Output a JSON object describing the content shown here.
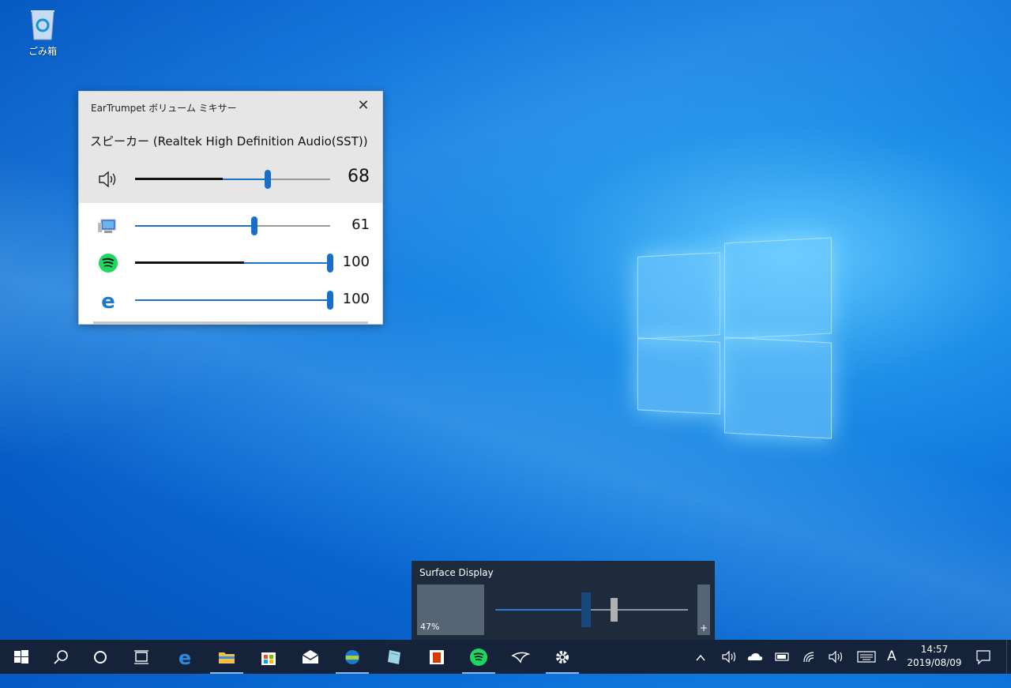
{
  "desktop": {
    "recycle_bin_label": "ごみ箱"
  },
  "mixer": {
    "title": "EarTrumpet ボリューム ミキサー",
    "device_name": "スピーカー (Realtek High Definition Audio(SST))",
    "master": {
      "icon": "speaker-icon",
      "volume": 68,
      "volume_text": "68",
      "peak": 0.45
    },
    "apps": [
      {
        "icon": "system-sounds-icon",
        "volume": 61,
        "volume_text": "61",
        "peak": 0
      },
      {
        "icon": "spotify-icon",
        "volume": 100,
        "volume_text": "100",
        "peak": 0.56
      },
      {
        "icon": "edge-icon",
        "volume": 100,
        "volume_text": "100",
        "peak": 0
      }
    ]
  },
  "brightness": {
    "title": "Surface Display",
    "level_text": "47%",
    "level": 47
  },
  "taskbar": {
    "apps": [
      "start-icon",
      "search-icon",
      "cortana-icon",
      "task-view-icon",
      "edge-icon",
      "file-explorer-icon",
      "store-icon",
      "mail-icon",
      "edge-dev-icon",
      "paint-icon",
      "office-lens-icon",
      "spotify-icon",
      "feedback-icon",
      "settings-icon"
    ],
    "ime": "A",
    "time": "14:57",
    "date": "2019/08/09"
  },
  "colors": {
    "accent": "#1670c9",
    "taskbar": "#15233a",
    "flyout": "#1e2b3c"
  }
}
